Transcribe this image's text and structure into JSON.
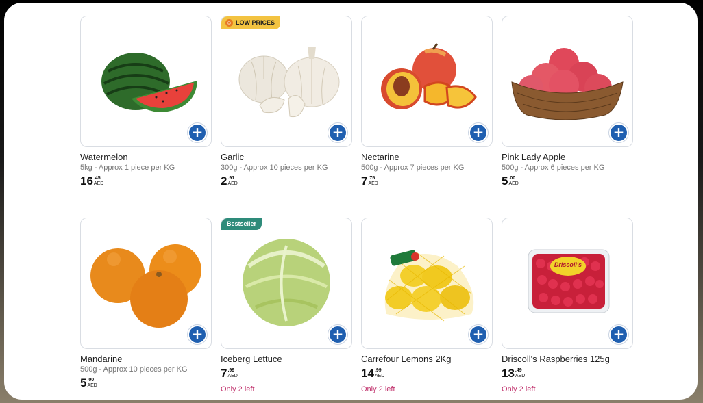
{
  "products": [
    {
      "name": "Watermelon",
      "desc": "5kg - Approx 1 piece per KG",
      "price_int": "16",
      "price_dec": ".45",
      "currency": "AED",
      "badge": "",
      "stock": ""
    },
    {
      "name": "Garlic",
      "desc": "300g - Approx 10 pieces per KG",
      "price_int": "2",
      "price_dec": ".91",
      "currency": "AED",
      "badge": "LOW PRICES",
      "stock": ""
    },
    {
      "name": "Nectarine",
      "desc": "500g - Approx 7 pieces per KG",
      "price_int": "7",
      "price_dec": ".75",
      "currency": "AED",
      "badge": "",
      "stock": ""
    },
    {
      "name": "Pink Lady Apple",
      "desc": "500g - Approx 6 pieces per KG",
      "price_int": "5",
      "price_dec": ".00",
      "currency": "AED",
      "badge": "",
      "stock": ""
    },
    {
      "name": "Mandarine",
      "desc": "500g - Approx 10 pieces per KG",
      "price_int": "5",
      "price_dec": ".00",
      "currency": "AED",
      "badge": "",
      "stock": ""
    },
    {
      "name": "Iceberg Lettuce",
      "desc": "",
      "price_int": "7",
      "price_dec": ".99",
      "currency": "AED",
      "badge": "Bestseller",
      "stock": "Only 2 left"
    },
    {
      "name": "Carrefour Lemons 2Kg",
      "desc": "",
      "price_int": "14",
      "price_dec": ".99",
      "currency": "AED",
      "badge": "",
      "stock": "Only 2 left"
    },
    {
      "name": "Driscoll's Raspberries 125g",
      "desc": "",
      "price_int": "13",
      "price_dec": ".49",
      "currency": "AED",
      "badge": "",
      "stock": "Only 2 left"
    }
  ],
  "add_label": "+",
  "package_label": "Driscoll's",
  "colors": {
    "add_button": "#1f5fb0",
    "low_price_badge": "#f3c341",
    "bestseller_badge": "#2e8b7a",
    "stock_text": "#c0306b"
  }
}
